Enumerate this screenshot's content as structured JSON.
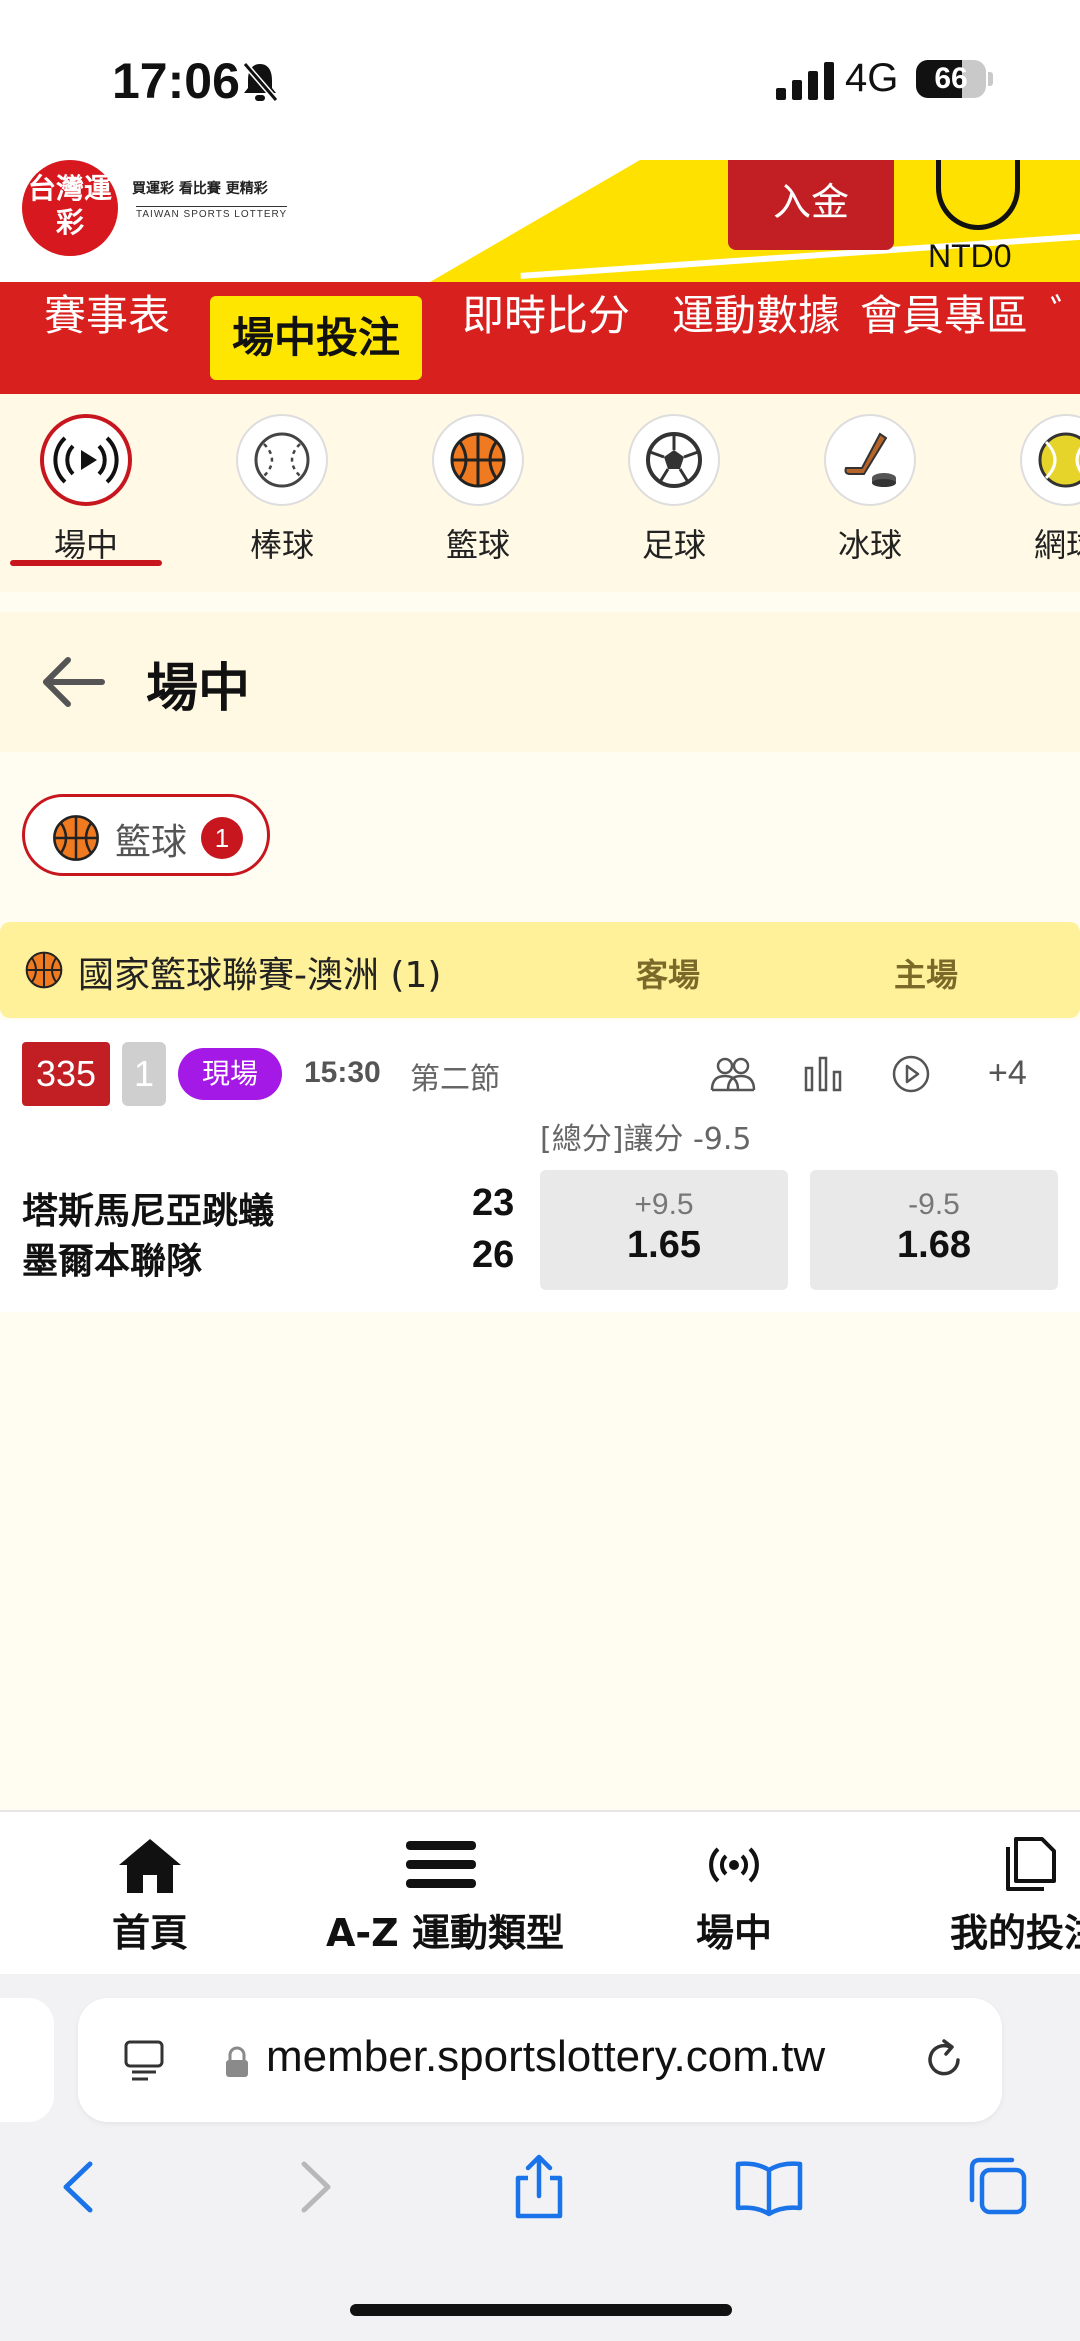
{
  "status": {
    "time": "17:06",
    "network": "4G",
    "battery": "66",
    "battery_level": 0.66
  },
  "header": {
    "logo_main": "台灣運彩",
    "logo_tagline": "買運彩 看比賽 更精彩",
    "logo_sub": "TAIWAN SPORTS LOTTERY",
    "deposit_label": "入金",
    "balance": "NTD0"
  },
  "main_nav": [
    "賽事表",
    "場中投注",
    "即時比分",
    "運動數據",
    "會員專區",
    "ﾞ"
  ],
  "sports_nav": [
    {
      "label": "場中",
      "icon": "live-broadcast-icon"
    },
    {
      "label": "棒球",
      "icon": "baseball-icon"
    },
    {
      "label": "籃球",
      "icon": "basketball-icon"
    },
    {
      "label": "足球",
      "icon": "soccer-ball-icon"
    },
    {
      "label": "冰球",
      "icon": "ice-hockey-icon"
    },
    {
      "label": "網球",
      "icon": "tennis-ball-icon"
    }
  ],
  "page": {
    "title": "場中"
  },
  "filter_chip": {
    "label": "籃球",
    "count": "1"
  },
  "league": {
    "name": "國家籃球聯賽-澳洲 (1)",
    "away_header": "客場",
    "home_header": "主場"
  },
  "match": {
    "id": "335",
    "number": "1",
    "live_label": "現場",
    "clock": "15:30",
    "period": "第二節",
    "more_markets": "+4",
    "market_label": "[總分]讓分 -9.5",
    "team_away": "塔斯馬尼亞跳蟻",
    "team_home": "墨爾本聯隊",
    "score_away": "23",
    "score_home": "26",
    "odds_away": {
      "line": "+9.5",
      "price": "1.65"
    },
    "odds_home": {
      "line": "-9.5",
      "price": "1.68"
    }
  },
  "tabbar": [
    {
      "label": "首頁",
      "icon": "home-icon"
    },
    {
      "label": "A-Z 運動類型",
      "icon": "menu-icon"
    },
    {
      "label": "場中",
      "icon": "live-icon"
    },
    {
      "label": "我的投注",
      "icon": "bets-icon"
    }
  ],
  "browser": {
    "url": "member.sportslottery.com.tw"
  },
  "colors": {
    "brand_red": "#d8201f",
    "accent_yellow": "#ffe600",
    "live_purple": "#a419e6"
  }
}
